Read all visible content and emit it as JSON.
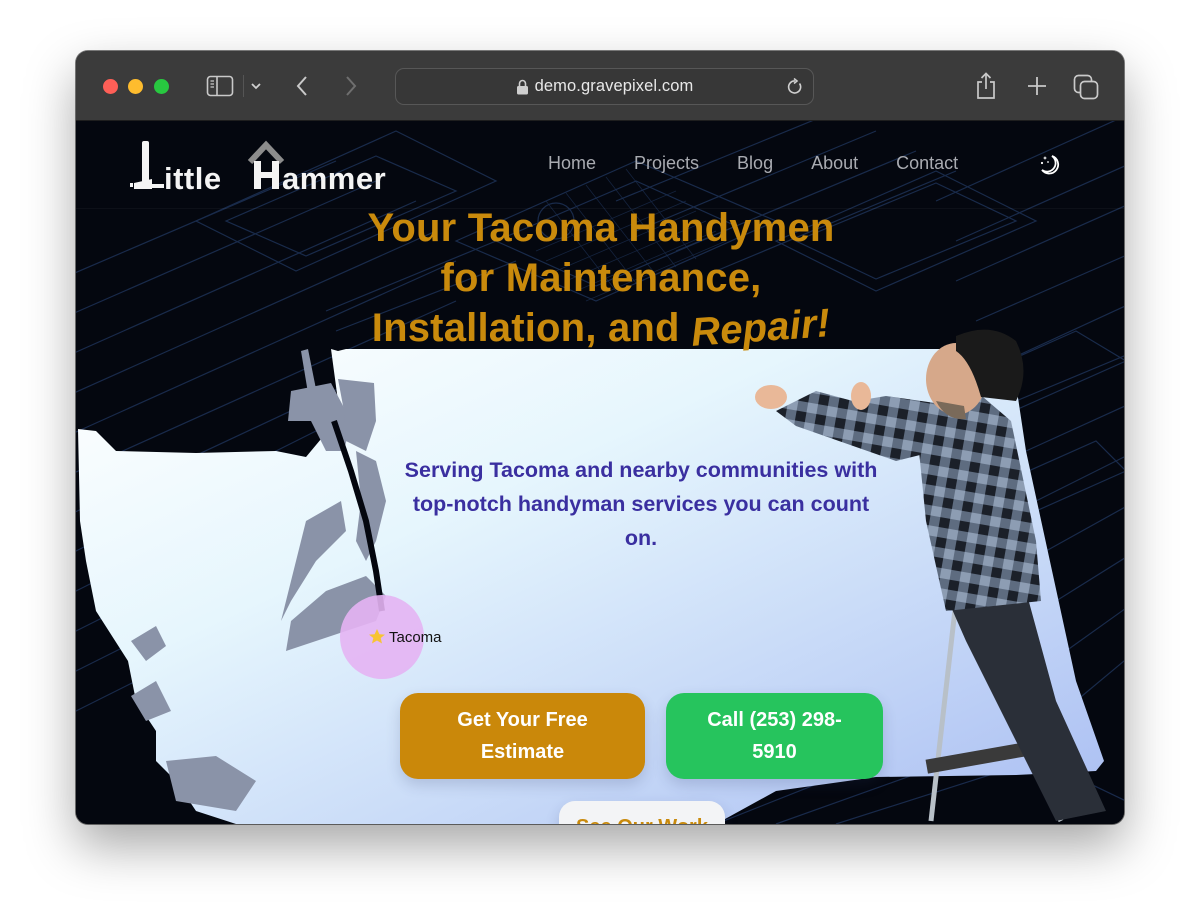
{
  "browser": {
    "url": "demo.gravepixel.com",
    "icons": {
      "sidebar": "sidebar-icon",
      "chevron": "chevron-down-icon",
      "back": "chevron-left-icon",
      "forward": "chevron-right-icon",
      "lock": "lock-icon",
      "reload": "reload-icon",
      "share": "share-icon",
      "new_tab": "plus-icon",
      "tabs": "tabs-overview-icon"
    }
  },
  "site": {
    "logo": {
      "word1": "ittle",
      "word2": "ammer",
      "full": "Little Hammer"
    },
    "nav": [
      {
        "label": "Home"
      },
      {
        "label": "Projects"
      },
      {
        "label": "Blog"
      },
      {
        "label": "About"
      },
      {
        "label": "Contact"
      }
    ],
    "theme_toggle_icon": "moon-stars-icon",
    "hero": {
      "title_line1": "Your Tacoma Handymen",
      "title_line2": "for Maintenance,",
      "title_line3_prefix": "Installation, and",
      "title_line3_emph": "Repair!",
      "subtitle": "Serving Tacoma and nearby communities with top-notch handyman services you can count on.",
      "map_label": "Tacoma",
      "map_marker_icon": "star-icon"
    },
    "buttons": {
      "estimate": "Get Your Free Estimate",
      "call": "Call (253) 298-5910",
      "work": "See Our Work"
    },
    "colors": {
      "accent_gold": "#c98a0c",
      "call_green": "#26c45d",
      "subtitle_purple": "#3a2fa0",
      "bg_dark": "#04070f"
    }
  }
}
